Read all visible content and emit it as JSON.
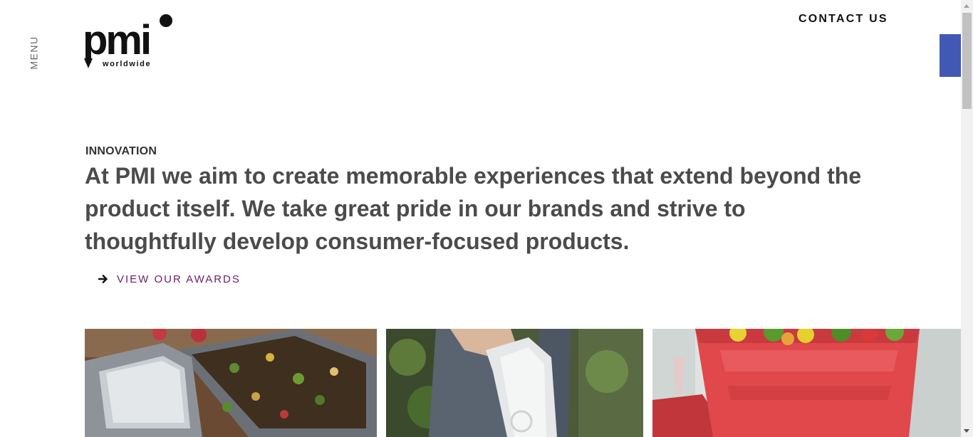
{
  "header": {
    "menu_label": "MENU",
    "logo": {
      "word": "pmi",
      "subtitle": "worldwide"
    },
    "contact_label": "CONTACT US"
  },
  "hero": {
    "eyebrow": "INNOVATION",
    "headline": "At PMI we aim to create memorable experiences that extend beyond the product itself. We take great pride in our brands and strive to thoughtfully develop consumer-focused products.",
    "cta_label": "VIEW OUR AWARDS"
  },
  "gallery": {
    "images": [
      {
        "icon": "food-storage-tray-image"
      },
      {
        "icon": "water-bottle-image"
      },
      {
        "icon": "salad-bowl-image"
      }
    ]
  },
  "colors": {
    "side_tab": "#4159b5",
    "cta_text": "#6a1f6a",
    "headline_text": "#4b4b4b"
  }
}
